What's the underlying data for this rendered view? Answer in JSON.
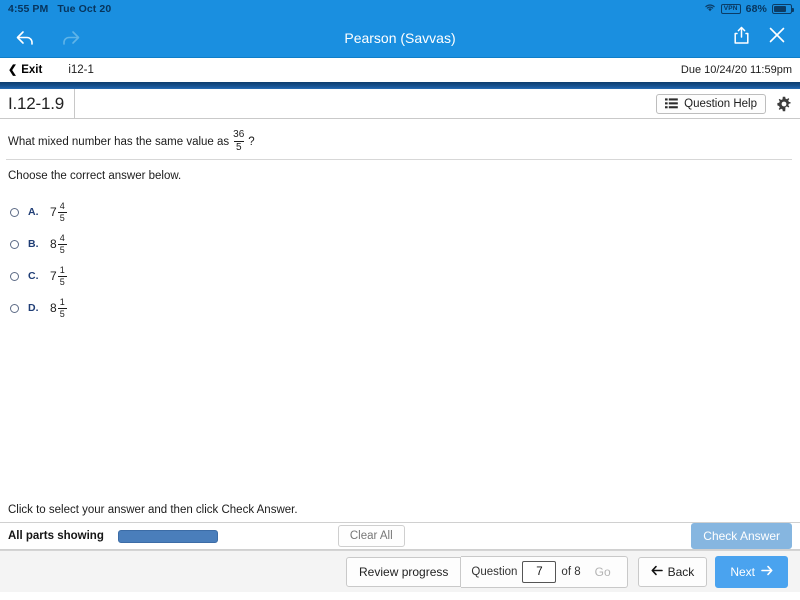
{
  "status_bar": {
    "time": "4:55 PM",
    "date": "Tue Oct 20",
    "wifi_icon": "wifi-icon",
    "vpn_label": "VPN",
    "battery_percent": "68%"
  },
  "appbar": {
    "title": "Pearson (Savvas)",
    "back_icon": "back-arrow-icon",
    "forward_icon": "forward-arrow-icon",
    "share_icon": "share-icon",
    "close_icon": "close-icon"
  },
  "exitbar": {
    "exit_label": "Exit",
    "assignment_id": "i12-1",
    "due_text": "Due 10/24/20 11:59pm"
  },
  "titlerow": {
    "question_title": "I.12-1.9",
    "question_help_label": "Question Help",
    "list_icon": "list-icon",
    "gear_icon": "gear-icon"
  },
  "question": {
    "prompt_prefix": "What mixed number has the same value as",
    "prompt_fraction": {
      "numerator": "36",
      "denominator": "5"
    },
    "prompt_suffix": "?",
    "instruction": "Choose the correct answer below.",
    "options": [
      {
        "letter": "A.",
        "whole": "7",
        "numerator": "4",
        "denominator": "5",
        "selected": false
      },
      {
        "letter": "B.",
        "whole": "8",
        "numerator": "4",
        "denominator": "5",
        "selected": false
      },
      {
        "letter": "C.",
        "whole": "7",
        "numerator": "1",
        "denominator": "5",
        "selected": false
      },
      {
        "letter": "D.",
        "whole": "8",
        "numerator": "1",
        "denominator": "5",
        "selected": false
      }
    ]
  },
  "footer": {
    "hint_text": "Click to select your answer and then click Check Answer.",
    "parts_label": "All parts showing",
    "progress_percent": "100",
    "clear_all_label": "Clear All",
    "check_answer_label": "Check Answer"
  },
  "bottom_nav": {
    "review_progress_label": "Review progress",
    "question_label": "Question",
    "question_number": "7",
    "of_label": "of 8",
    "go_label": "Go",
    "back_label": "Back",
    "next_label": "Next"
  },
  "colors": {
    "brand_blue": "#1a8fe0",
    "header_rule": "#0d3c6e",
    "accent_next": "#4aa3ef",
    "progress": "#4a7ebb",
    "option_letter": "#1f3d75"
  }
}
